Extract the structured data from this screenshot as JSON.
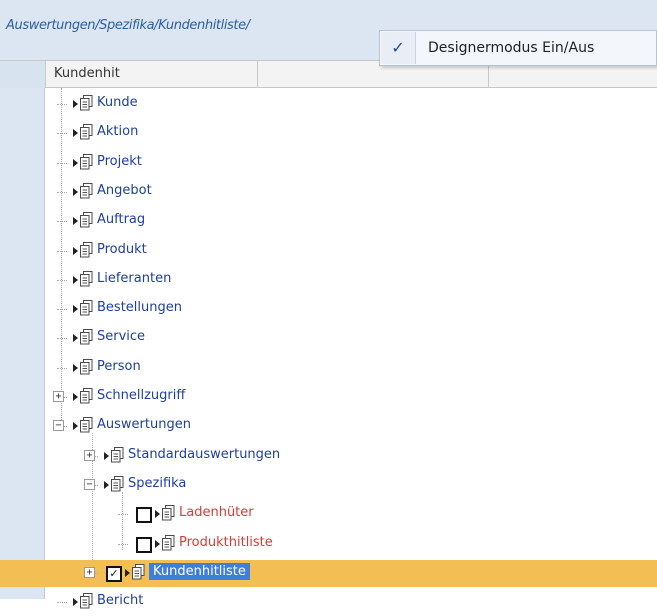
{
  "path": "Auswertungen/Spezifika/Kundenhitliste/",
  "popup": {
    "checkmark": "✓",
    "label": "Designermodus Ein/Aus"
  },
  "column_header": "Kundenhit",
  "tree": [
    {
      "label": "Kunde"
    },
    {
      "label": "Aktion"
    },
    {
      "label": "Projekt"
    },
    {
      "label": "Angebot"
    },
    {
      "label": "Auftrag"
    },
    {
      "label": "Produkt"
    },
    {
      "label": "Lieferanten"
    },
    {
      "label": "Bestellungen"
    },
    {
      "label": "Service"
    },
    {
      "label": "Person"
    },
    {
      "label": "Schnellzugriff",
      "expander": "+"
    },
    {
      "label": "Auswertungen",
      "expander": "−"
    },
    {
      "label": "Standardauswertungen",
      "expander": "+"
    },
    {
      "label": "Spezifika",
      "expander": "−"
    },
    {
      "label": "Ladenhüter",
      "checked": false
    },
    {
      "label": "Produkthitliste",
      "checked": false
    },
    {
      "label": "Kundenhitliste",
      "checked": true,
      "expander": "+",
      "selected": true
    },
    {
      "label": "Bericht"
    }
  ],
  "colors": {
    "selection_row": "#f3bf55",
    "selected_label": "#3e7fd9",
    "link": "#1f3f9e",
    "red_item": "#d73a35"
  }
}
